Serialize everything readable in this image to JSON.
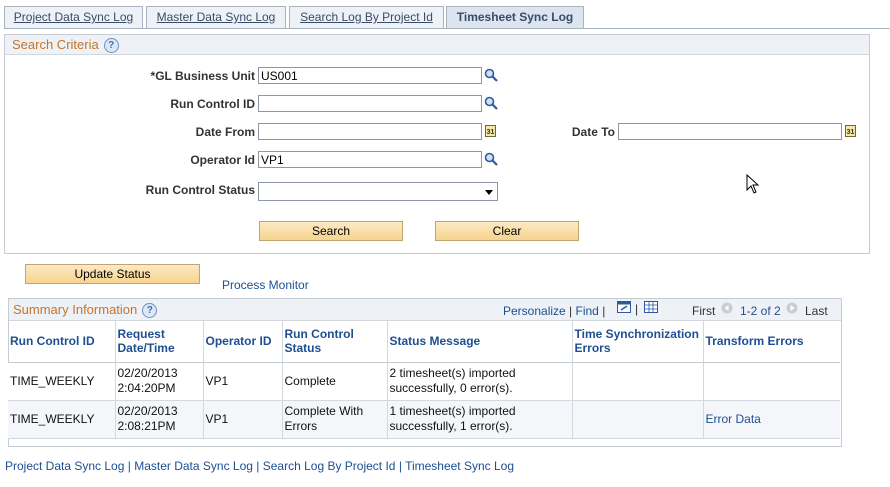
{
  "tabs": [
    {
      "label": "Project Data Sync Log",
      "active": false
    },
    {
      "label": "Master Data Sync Log",
      "active": false
    },
    {
      "label": "Search Log By Project Id",
      "active": false
    },
    {
      "label": "Timesheet Sync Log",
      "active": true
    }
  ],
  "search": {
    "title": "Search Criteria",
    "help": "?",
    "gl_business_unit": {
      "label": "*GL Business Unit",
      "value": "US001"
    },
    "run_control_id": {
      "label": "Run Control ID",
      "value": ""
    },
    "date_from": {
      "label": "Date From",
      "value": ""
    },
    "date_to": {
      "label": "Date To",
      "value": ""
    },
    "operator_id": {
      "label": "Operator Id",
      "value": "VP1"
    },
    "run_control_status": {
      "label": "Run Control Status",
      "value": ""
    },
    "calendar_glyph": "31",
    "search_button": "Search",
    "clear_button": "Clear"
  },
  "actions": {
    "update_status_button": "Update Status",
    "process_monitor_link": "Process Monitor"
  },
  "summary": {
    "title": "Summary Information",
    "help": "?",
    "personalize": "Personalize",
    "sep": "|",
    "find": "Find",
    "first": "First",
    "range": "1-2 of 2",
    "last": "Last",
    "columns": [
      "Run Control ID",
      "Request Date/Time",
      "Operator ID",
      "Run Control Status",
      "Status Message",
      "Time Synchronization Errors",
      "Transform Errors"
    ],
    "rows": [
      {
        "run_control_id": "TIME_WEEKLY",
        "date": "02/20/2013",
        "time": "2:04:20PM",
        "operator": "VP1",
        "status_line1": "Complete",
        "status_line2": "",
        "msg_line1": "2 timesheet(s) imported",
        "msg_line2": "successfully, 0 error(s).",
        "time_sync_errors": "",
        "transform_errors": ""
      },
      {
        "run_control_id": "TIME_WEEKLY",
        "date": "02/20/2013",
        "time": "2:08:21PM",
        "operator": "VP1",
        "status_line1": "Complete With",
        "status_line2": "Errors",
        "msg_line1": "1 timesheet(s) imported",
        "msg_line2": "successfully, 1 error(s).",
        "time_sync_errors": "",
        "transform_errors": "Error Data"
      }
    ]
  },
  "footer_links": [
    "Project Data Sync Log",
    "Master Data Sync Log",
    "Search Log By Project Id",
    "Timesheet Sync Log"
  ],
  "footer_sep": " | ",
  "colors": {
    "accent": "#1d4f91",
    "section_title": "#c3752a",
    "button": "#f7d48f"
  }
}
